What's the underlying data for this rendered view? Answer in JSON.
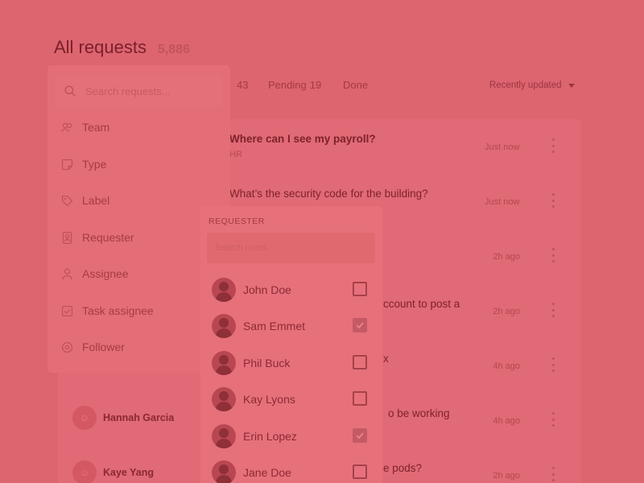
{
  "header": {
    "title": "All requests",
    "count": "5,886"
  },
  "tabs": [
    {
      "label": "",
      "count": "43"
    },
    {
      "label": "Pending",
      "count": "19"
    },
    {
      "label": "Done",
      "count": ""
    }
  ],
  "sort": {
    "label": "Recently updated"
  },
  "requests": [
    {
      "subject": "Where can I see my payroll?",
      "tag": "HR",
      "time": "Just now",
      "bold": true
    },
    {
      "subject": "What’s the security code for the building?",
      "tag": "",
      "time": "Just now",
      "bold": false
    },
    {
      "subject": "",
      "tag": "",
      "time": "2h ago",
      "bold": false
    },
    {
      "subject": "ccount to post a",
      "tag": "",
      "time": "2h ago",
      "bold": false
    },
    {
      "subject": "x",
      "tag": "",
      "time": "4h ago",
      "bold": false
    },
    {
      "subject": "o be working",
      "tag": "",
      "time": "4h ago",
      "bold": false,
      "person": "Hannah Garcia"
    },
    {
      "subject": "e pods?",
      "tag": "",
      "time": "2h ago",
      "bold": false,
      "person": "Kaye Yang"
    }
  ],
  "filter_menu": {
    "search_placeholder": "Search requests...",
    "items": [
      {
        "label": "Team",
        "icon": "team-icon"
      },
      {
        "label": "Type",
        "icon": "type-icon"
      },
      {
        "label": "Label",
        "icon": "label-icon"
      },
      {
        "label": "Requester",
        "icon": "requester-icon"
      },
      {
        "label": "Assignee",
        "icon": "assignee-icon"
      },
      {
        "label": "Task assignee",
        "icon": "task-assignee-icon"
      },
      {
        "label": "Follower",
        "icon": "follower-icon"
      }
    ]
  },
  "requester_panel": {
    "heading": "REQUESTER",
    "search_placeholder": "Search users",
    "users": [
      {
        "name": "John Doe",
        "checked": false
      },
      {
        "name": "Sam Emmet",
        "checked": true
      },
      {
        "name": "Phil Buck",
        "checked": false
      },
      {
        "name": "Kay Lyons",
        "checked": false
      },
      {
        "name": "Erin Lopez",
        "checked": true
      },
      {
        "name": "Jane Doe",
        "checked": false
      }
    ]
  },
  "colors": {
    "overlay": "#dc6570",
    "text_dark": "#7b2029"
  }
}
